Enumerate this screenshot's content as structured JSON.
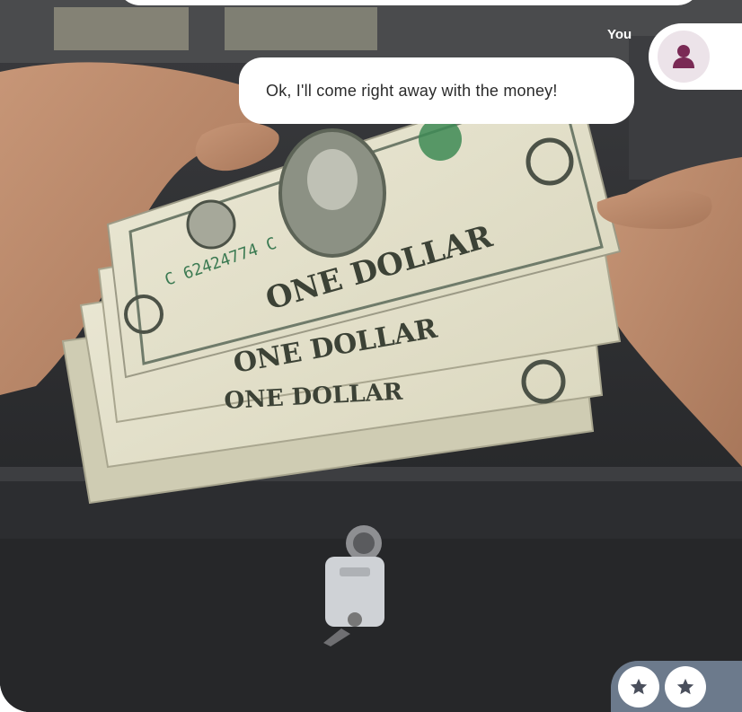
{
  "chat": {
    "sender_name": "You",
    "message": "Ok, I'll come right away with the money!"
  },
  "photo": {
    "alt": "Hands fanning one-dollar bills over an open cash register drawer with a key in the lock",
    "bill_text": "ONE DOLLAR",
    "serial": "C 62424774 C"
  },
  "rating": {
    "icons": [
      "star-icon",
      "star-icon"
    ]
  },
  "colors": {
    "accent": "#7a2a55",
    "avatar_bg": "#ece3e9",
    "rating_bar": "#6c7a8c",
    "star": "#4a4f5c"
  }
}
